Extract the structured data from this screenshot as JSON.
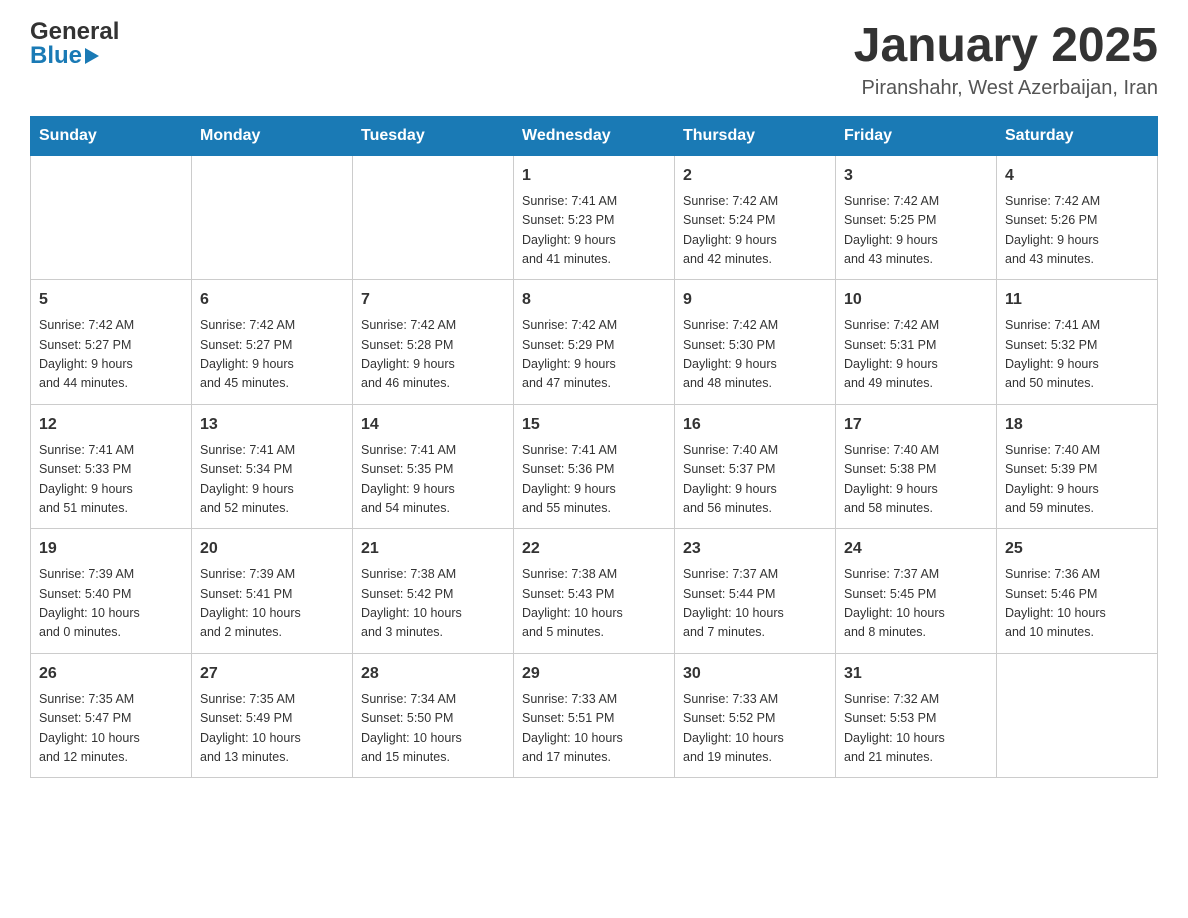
{
  "header": {
    "logo_line1": "General",
    "logo_line2": "Blue",
    "month_year": "January 2025",
    "location": "Piranshahr, West Azerbaijan, Iran"
  },
  "days_of_week": [
    "Sunday",
    "Monday",
    "Tuesday",
    "Wednesday",
    "Thursday",
    "Friday",
    "Saturday"
  ],
  "weeks": [
    [
      {
        "day": "",
        "info": ""
      },
      {
        "day": "",
        "info": ""
      },
      {
        "day": "",
        "info": ""
      },
      {
        "day": "1",
        "info": "Sunrise: 7:41 AM\nSunset: 5:23 PM\nDaylight: 9 hours\nand 41 minutes."
      },
      {
        "day": "2",
        "info": "Sunrise: 7:42 AM\nSunset: 5:24 PM\nDaylight: 9 hours\nand 42 minutes."
      },
      {
        "day": "3",
        "info": "Sunrise: 7:42 AM\nSunset: 5:25 PM\nDaylight: 9 hours\nand 43 minutes."
      },
      {
        "day": "4",
        "info": "Sunrise: 7:42 AM\nSunset: 5:26 PM\nDaylight: 9 hours\nand 43 minutes."
      }
    ],
    [
      {
        "day": "5",
        "info": "Sunrise: 7:42 AM\nSunset: 5:27 PM\nDaylight: 9 hours\nand 44 minutes."
      },
      {
        "day": "6",
        "info": "Sunrise: 7:42 AM\nSunset: 5:27 PM\nDaylight: 9 hours\nand 45 minutes."
      },
      {
        "day": "7",
        "info": "Sunrise: 7:42 AM\nSunset: 5:28 PM\nDaylight: 9 hours\nand 46 minutes."
      },
      {
        "day": "8",
        "info": "Sunrise: 7:42 AM\nSunset: 5:29 PM\nDaylight: 9 hours\nand 47 minutes."
      },
      {
        "day": "9",
        "info": "Sunrise: 7:42 AM\nSunset: 5:30 PM\nDaylight: 9 hours\nand 48 minutes."
      },
      {
        "day": "10",
        "info": "Sunrise: 7:42 AM\nSunset: 5:31 PM\nDaylight: 9 hours\nand 49 minutes."
      },
      {
        "day": "11",
        "info": "Sunrise: 7:41 AM\nSunset: 5:32 PM\nDaylight: 9 hours\nand 50 minutes."
      }
    ],
    [
      {
        "day": "12",
        "info": "Sunrise: 7:41 AM\nSunset: 5:33 PM\nDaylight: 9 hours\nand 51 minutes."
      },
      {
        "day": "13",
        "info": "Sunrise: 7:41 AM\nSunset: 5:34 PM\nDaylight: 9 hours\nand 52 minutes."
      },
      {
        "day": "14",
        "info": "Sunrise: 7:41 AM\nSunset: 5:35 PM\nDaylight: 9 hours\nand 54 minutes."
      },
      {
        "day": "15",
        "info": "Sunrise: 7:41 AM\nSunset: 5:36 PM\nDaylight: 9 hours\nand 55 minutes."
      },
      {
        "day": "16",
        "info": "Sunrise: 7:40 AM\nSunset: 5:37 PM\nDaylight: 9 hours\nand 56 minutes."
      },
      {
        "day": "17",
        "info": "Sunrise: 7:40 AM\nSunset: 5:38 PM\nDaylight: 9 hours\nand 58 minutes."
      },
      {
        "day": "18",
        "info": "Sunrise: 7:40 AM\nSunset: 5:39 PM\nDaylight: 9 hours\nand 59 minutes."
      }
    ],
    [
      {
        "day": "19",
        "info": "Sunrise: 7:39 AM\nSunset: 5:40 PM\nDaylight: 10 hours\nand 0 minutes."
      },
      {
        "day": "20",
        "info": "Sunrise: 7:39 AM\nSunset: 5:41 PM\nDaylight: 10 hours\nand 2 minutes."
      },
      {
        "day": "21",
        "info": "Sunrise: 7:38 AM\nSunset: 5:42 PM\nDaylight: 10 hours\nand 3 minutes."
      },
      {
        "day": "22",
        "info": "Sunrise: 7:38 AM\nSunset: 5:43 PM\nDaylight: 10 hours\nand 5 minutes."
      },
      {
        "day": "23",
        "info": "Sunrise: 7:37 AM\nSunset: 5:44 PM\nDaylight: 10 hours\nand 7 minutes."
      },
      {
        "day": "24",
        "info": "Sunrise: 7:37 AM\nSunset: 5:45 PM\nDaylight: 10 hours\nand 8 minutes."
      },
      {
        "day": "25",
        "info": "Sunrise: 7:36 AM\nSunset: 5:46 PM\nDaylight: 10 hours\nand 10 minutes."
      }
    ],
    [
      {
        "day": "26",
        "info": "Sunrise: 7:35 AM\nSunset: 5:47 PM\nDaylight: 10 hours\nand 12 minutes."
      },
      {
        "day": "27",
        "info": "Sunrise: 7:35 AM\nSunset: 5:49 PM\nDaylight: 10 hours\nand 13 minutes."
      },
      {
        "day": "28",
        "info": "Sunrise: 7:34 AM\nSunset: 5:50 PM\nDaylight: 10 hours\nand 15 minutes."
      },
      {
        "day": "29",
        "info": "Sunrise: 7:33 AM\nSunset: 5:51 PM\nDaylight: 10 hours\nand 17 minutes."
      },
      {
        "day": "30",
        "info": "Sunrise: 7:33 AM\nSunset: 5:52 PM\nDaylight: 10 hours\nand 19 minutes."
      },
      {
        "day": "31",
        "info": "Sunrise: 7:32 AM\nSunset: 5:53 PM\nDaylight: 10 hours\nand 21 minutes."
      },
      {
        "day": "",
        "info": ""
      }
    ]
  ]
}
